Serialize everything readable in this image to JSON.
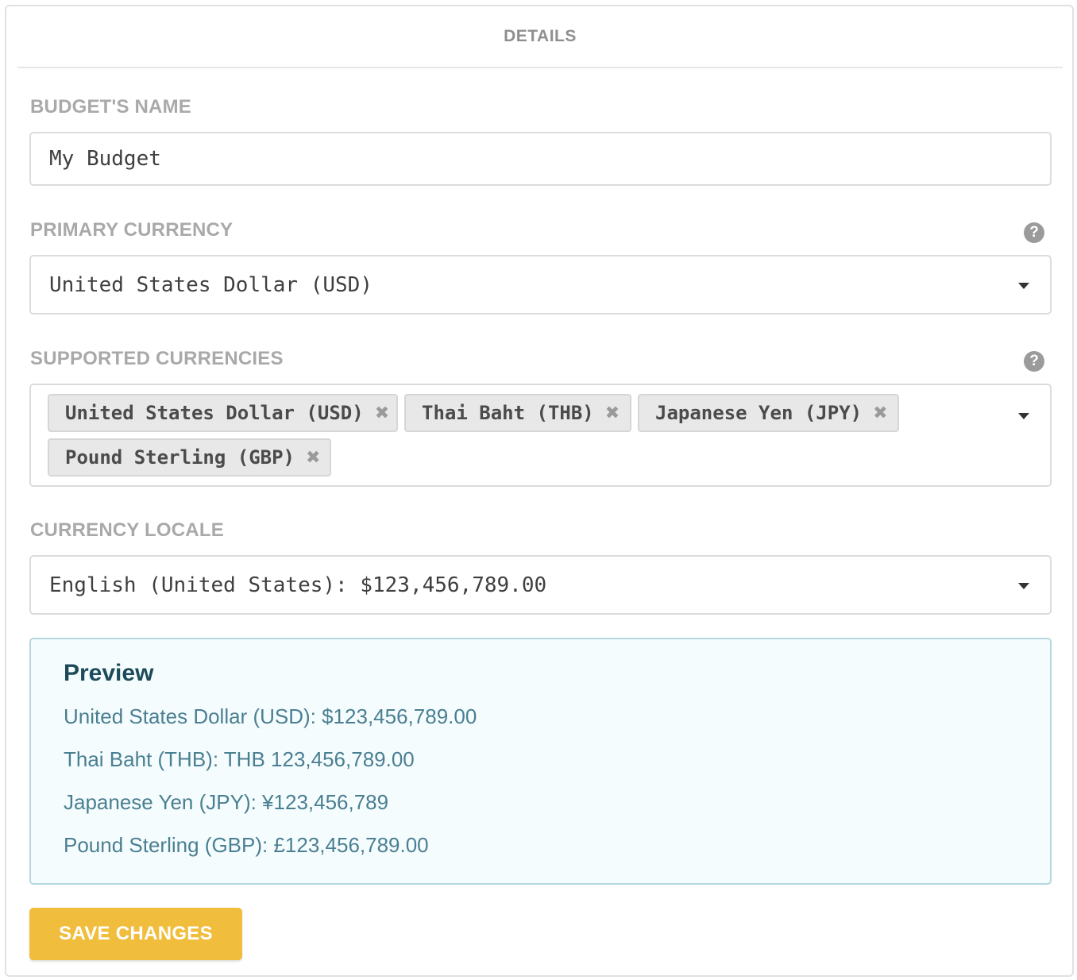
{
  "panel": {
    "title": "DETAILS"
  },
  "budget_name": {
    "label": "BUDGET'S NAME",
    "value": "My Budget"
  },
  "primary_currency": {
    "label": "PRIMARY CURRENCY",
    "selected": "United States Dollar (USD)",
    "help_icon": "question-circle-icon"
  },
  "supported_currencies": {
    "label": "SUPPORTED CURRENCIES",
    "help_icon": "question-circle-icon",
    "tags": [
      {
        "label": "United States Dollar (USD)",
        "remove": "✖"
      },
      {
        "label": "Thai Baht (THB)",
        "remove": "✖"
      },
      {
        "label": "Japanese Yen (JPY)",
        "remove": "✖"
      },
      {
        "label": "Pound Sterling (GBP)",
        "remove": "✖"
      }
    ]
  },
  "currency_locale": {
    "label": "CURRENCY LOCALE",
    "selected": "English (United States): $123,456,789.00"
  },
  "preview": {
    "title": "Preview",
    "lines": [
      "United States Dollar (USD): $123,456,789.00",
      "Thai Baht (THB): THB 123,456,789.00",
      "Japanese Yen (JPY): ¥123,456,789",
      "Pound Sterling (GBP): £123,456,789.00"
    ]
  },
  "save_button": {
    "label": "SAVE CHANGES"
  },
  "colors": {
    "accent": "#f0bd3c",
    "preview_bg": "#f5fcfd",
    "preview_border": "#b5d8df",
    "preview_title": "#1c4a5a",
    "preview_text": "#4a7f92",
    "label": "#a9a9a9"
  }
}
